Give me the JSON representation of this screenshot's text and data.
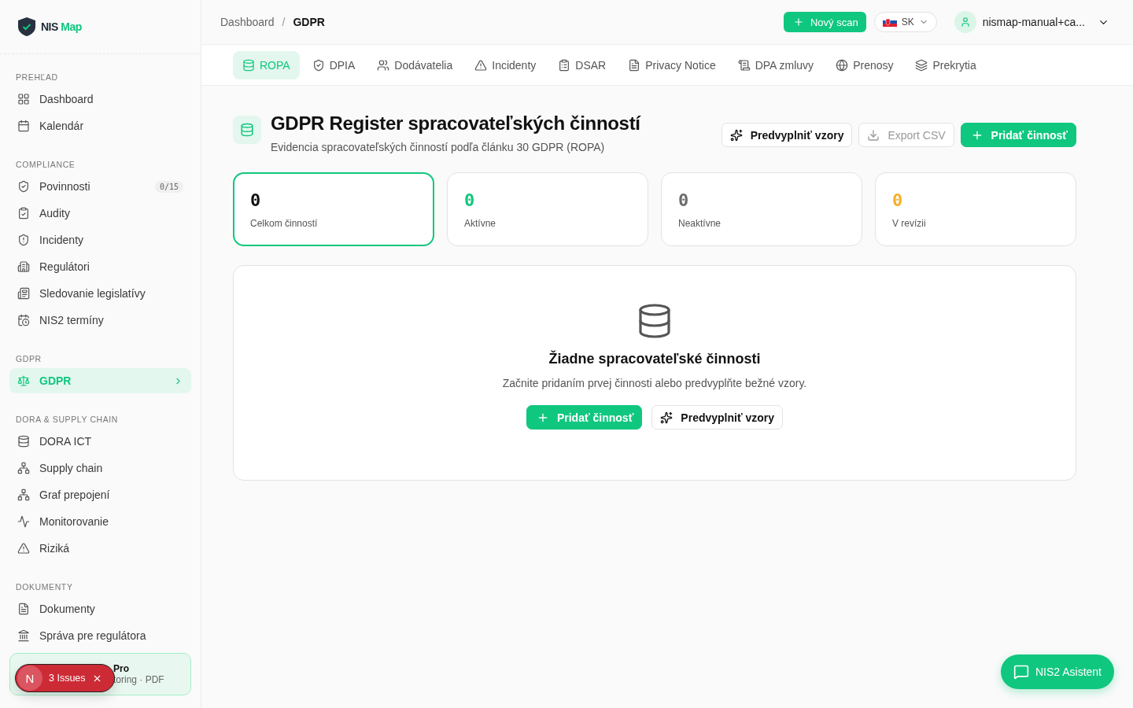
{
  "brand": {
    "name": "NIS",
    "accent": "Map"
  },
  "sidebar": {
    "sections": [
      {
        "title": "PREHĽAD",
        "items": [
          {
            "label": "Dashboard",
            "selected": false
          },
          {
            "label": "Kalendár",
            "selected": false
          }
        ]
      },
      {
        "title": "COMPLIANCE",
        "items": [
          {
            "label": "Povinnosti",
            "selected": false,
            "badge": "0/15"
          },
          {
            "label": "Audity",
            "selected": false
          },
          {
            "label": "Incidenty",
            "selected": false
          },
          {
            "label": "Regulátori",
            "selected": false
          },
          {
            "label": "Sledovanie legislatívy",
            "selected": false
          },
          {
            "label": "NIS2 termíny",
            "selected": false
          }
        ]
      },
      {
        "title": "GDPR",
        "items": [
          {
            "label": "GDPR",
            "selected": true
          }
        ]
      },
      {
        "title": "DORA & SUPPLY CHAIN",
        "items": [
          {
            "label": "DORA ICT",
            "selected": false
          },
          {
            "label": "Supply chain",
            "selected": false
          },
          {
            "label": "Graf prepojení",
            "selected": false
          },
          {
            "label": "Monitorovanie",
            "selected": false
          },
          {
            "label": "Riziká",
            "selected": false
          }
        ]
      },
      {
        "title": "DOKUMENTY",
        "items": [
          {
            "label": "Dokumenty",
            "selected": false
          },
          {
            "label": "Správa pre regulátora",
            "selected": false
          }
        ]
      }
    ],
    "promo": {
      "title": "Pro",
      "subtitle": "toring · PDF"
    }
  },
  "issues_badge": {
    "letter": "N",
    "label": "3 Issues"
  },
  "breadcrumb": {
    "items": [
      "Dashboard",
      "GDPR"
    ],
    "separator": "/"
  },
  "header": {
    "scan_button": "Nový scan",
    "language": "SK",
    "user": "nismap-manual+ca..."
  },
  "tabs": [
    {
      "label": "ROPA",
      "selected": true
    },
    {
      "label": "DPIA",
      "selected": false
    },
    {
      "label": "Dodávatelia",
      "selected": false
    },
    {
      "label": "Incidenty",
      "selected": false
    },
    {
      "label": "DSAR",
      "selected": false
    },
    {
      "label": "Privacy Notice",
      "selected": false
    },
    {
      "label": "DPA zmluvy",
      "selected": false
    },
    {
      "label": "Prenosy",
      "selected": false
    },
    {
      "label": "Prekrytia",
      "selected": false
    }
  ],
  "page": {
    "title": "GDPR Register spracovateľských činností",
    "subtitle": "Evidencia spracovateľských činností podľa článku 30 GDPR (ROPA)",
    "actions": [
      {
        "label": "Predvyplniť vzory",
        "kind": "prefill"
      },
      {
        "label": "Export CSV",
        "kind": "export",
        "disabled": true
      },
      {
        "label": "Pridať činnosť",
        "kind": "primary"
      }
    ]
  },
  "stats": [
    {
      "value": "0",
      "label": "Celkom činností",
      "color": "#111111",
      "selected": true
    },
    {
      "value": "0",
      "label": "Aktívne",
      "color": "#10c77f",
      "selected": false
    },
    {
      "value": "0",
      "label": "Neaktívne",
      "color": "#6b6b6b",
      "selected": false
    },
    {
      "value": "0",
      "label": "V revízii",
      "color": "#f5b027",
      "selected": false
    }
  ],
  "empty": {
    "title": "Žiadne spracovateľské činnosti",
    "text": "Začnite pridaním prvej činnosti alebo predvyplňte bežné vzory.",
    "actions": [
      {
        "label": "Pridať činnosť",
        "kind": "primary"
      },
      {
        "label": "Predvyplniť vzory",
        "kind": "prefill"
      }
    ]
  },
  "assistant_button": "NIS2 Asistent"
}
